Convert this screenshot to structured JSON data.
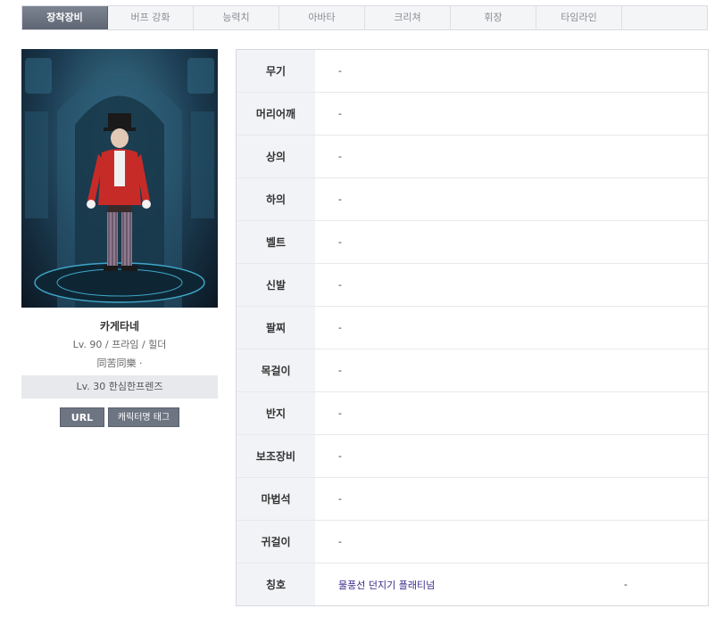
{
  "tabs": [
    {
      "label": "장착장비",
      "active": true
    },
    {
      "label": "버프 강화",
      "active": false
    },
    {
      "label": "능력치",
      "active": false
    },
    {
      "label": "아바타",
      "active": false
    },
    {
      "label": "크리쳐",
      "active": false
    },
    {
      "label": "휘장",
      "active": false
    },
    {
      "label": "타임라인",
      "active": false
    }
  ],
  "character": {
    "name": "카게타네",
    "info": "Lv. 90 / 프라임 / 힐더",
    "guild": "同苦同樂 ·",
    "adventure": "Lv. 30 한심한프렌즈"
  },
  "buttons": {
    "url": "URL",
    "tag": "캐릭터명 태그"
  },
  "equipment": [
    {
      "slot": "무기",
      "value": "-"
    },
    {
      "slot": "머리어깨",
      "value": "-"
    },
    {
      "slot": "상의",
      "value": "-"
    },
    {
      "slot": "하의",
      "value": "-"
    },
    {
      "slot": "벨트",
      "value": "-"
    },
    {
      "slot": "신발",
      "value": "-"
    },
    {
      "slot": "팔찌",
      "value": "-"
    },
    {
      "slot": "목걸이",
      "value": "-"
    },
    {
      "slot": "반지",
      "value": "-"
    },
    {
      "slot": "보조장비",
      "value": "-"
    },
    {
      "slot": "마법석",
      "value": "-"
    },
    {
      "slot": "귀걸이",
      "value": "-"
    },
    {
      "slot": "칭호",
      "value": "물풍선 던지기 플래티넘",
      "extra": "-"
    }
  ],
  "colors": {
    "active_tab": "#6f7682",
    "title_text": "#3b2a8a",
    "button": "#6d7482"
  }
}
